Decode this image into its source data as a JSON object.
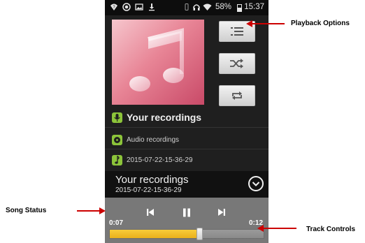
{
  "status_bar": {
    "icons": [
      "wifi-question-icon",
      "record-icon",
      "image-icon",
      "download-icon",
      "vibrate-icon",
      "headset-icon",
      "wifi-icon",
      "battery-icon"
    ],
    "battery_pct": "58%",
    "time": "15:37"
  },
  "player": {
    "album_art_icon": "music-note-icon",
    "options": [
      {
        "name": "playlist-button",
        "icon": "playlist-icon"
      },
      {
        "name": "shuffle-button",
        "icon": "shuffle-icon"
      },
      {
        "name": "repeat-button",
        "icon": "repeat-icon"
      }
    ],
    "info": {
      "artist": "Your recordings",
      "album": "Audio recordings",
      "title": "2015-07-22-15-36-29"
    },
    "now_playing": {
      "title": "Your recordings",
      "subtitle": "2015-07-22-15-36-29"
    },
    "time_current": "0:07",
    "time_total": "0:12",
    "progress": 0.58,
    "controls": [
      "previous-icon",
      "pause-icon",
      "next-icon"
    ]
  },
  "callouts": {
    "playback_options": "Playback Options",
    "song_status": "Song Status",
    "track_controls": "Track Controls"
  },
  "colors": {
    "accent_green": "#8cc43a",
    "progress_yellow": "#f8cc3a",
    "arrow_red": "#cc0000"
  }
}
